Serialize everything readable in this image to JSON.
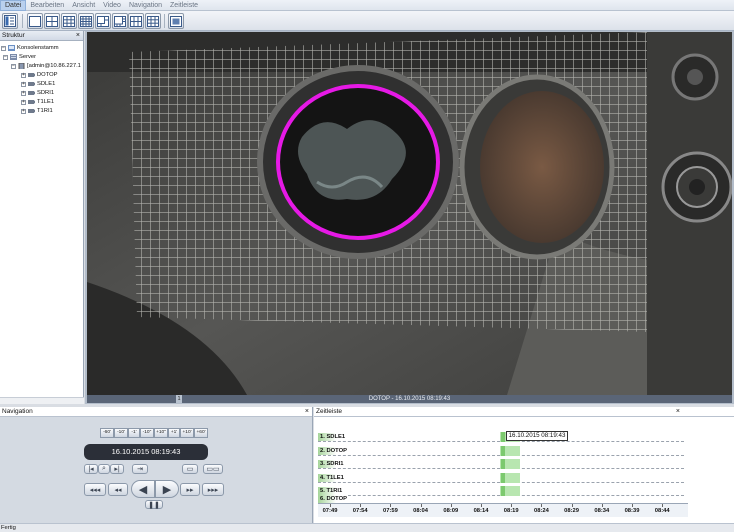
{
  "menu": [
    "Datei",
    "Bearbeiten",
    "Ansicht",
    "Video",
    "Navigation",
    "Zeitleiste"
  ],
  "structure_panel": {
    "title": "Struktur",
    "close": "×",
    "tree": {
      "root": "Konsolenstamm",
      "server": "Server",
      "connection": "[admin@10.86.227.1",
      "cameras": [
        "DOTOP",
        "SDLE1",
        "SDRI1",
        "T1LE1",
        "T1RI1"
      ]
    }
  },
  "video": {
    "caption": "DOTOP - 16.10.2015 08:19:43",
    "slot_number": "1"
  },
  "navigation_panel": {
    "title": "Navigation",
    "close": "×",
    "jump_buttons": [
      "-60'",
      "-10'",
      "-1'",
      "-10\"",
      "+10\"",
      "+1'",
      "+10'",
      "+60'"
    ],
    "current_time": "16.10.2015 08:19:43"
  },
  "timeline_panel": {
    "title": "Zeitleiste",
    "close": "×",
    "current_time": "16.10.2015 08:19:43",
    "tracks": [
      "1. SDLE1",
      "2. DOTOP",
      "3. SDRI1",
      "4. T1LE1",
      "5. T1RI1",
      "6. DOTOP"
    ],
    "ticks": [
      "07:49",
      "07:54",
      "07:59",
      "08:04",
      "08:09",
      "08:14",
      "08:19",
      "08:24",
      "08:29",
      "08:34",
      "08:39",
      "08:44"
    ]
  },
  "status_bar": "Fertig",
  "colors": {
    "highlight_circle": "#e619e6",
    "recording": "#b8e6b0",
    "nav_time_bg": "#2b2f38"
  }
}
